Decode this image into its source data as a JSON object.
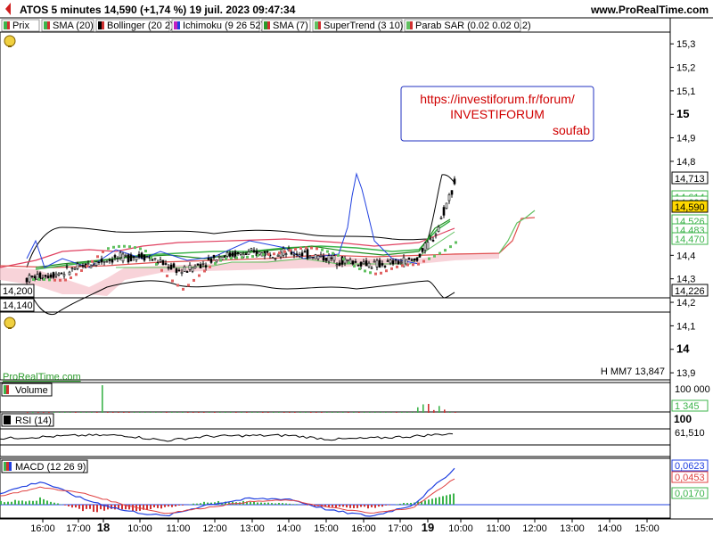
{
  "header": {
    "title": "ATOS 5 minutes 14,590 (+1,74 %) 19 juil. 2023 09:47:34",
    "site": "www.ProRealTime.com"
  },
  "legend": [
    {
      "label": "Prix",
      "color": "#3cb44b"
    },
    {
      "label": "SMA (20)",
      "color": "#3cb44b"
    },
    {
      "label": "Bollinger (20 2)",
      "color": "#000000"
    },
    {
      "label": "Ichimoku (9 26 52)",
      "color": "#c020c0"
    },
    {
      "label": "SMA (7)",
      "color": "#2a9a2a"
    },
    {
      "label": "SuperTrend (3 10)",
      "color": "#60c060"
    },
    {
      "label": "Parab SAR (0.02 0.02 0.2)",
      "color": "#60c060"
    }
  ],
  "annotation": {
    "line1": "https://investiforum.fr/forum/",
    "line2": "INVESTIFORUM",
    "line3": "soufab"
  },
  "watermark": "ProRealTime.com",
  "price_axis": {
    "ticks": [
      "15,3",
      "15,2",
      "15,1",
      "15",
      "14,9",
      "14,8",
      "14,4",
      "14,3",
      "14,2",
      "14,1",
      "14",
      "13,9"
    ],
    "badges": [
      {
        "text": "14,713",
        "color": "#ffffff",
        "border": "#000000"
      },
      {
        "text": "14,614",
        "color": "#ffffff",
        "border": "#3cb44b"
      },
      {
        "text": "14,600",
        "color": "#ffffff",
        "border": "#3cb44b"
      },
      {
        "text": "14,590",
        "color": "#ffd800",
        "border": "#000000"
      },
      {
        "text": "14,526",
        "color": "#ffffff",
        "border": "#3cb44b"
      },
      {
        "text": "14,483",
        "color": "#ffffff",
        "border": "#3cb44b"
      },
      {
        "text": "14,470",
        "color": "#ffffff",
        "border": "#3cb44b"
      },
      {
        "text": "14,226",
        "color": "#ffffff",
        "border": "#000000"
      }
    ],
    "left_levels": [
      "14,200",
      "14,140"
    ],
    "mm_label": "H MM7 13,847"
  },
  "panels": {
    "volume": {
      "label": "Volume",
      "ticks": [
        "100 000"
      ],
      "value": "1 345"
    },
    "rsi": {
      "label": "RSI (14)",
      "ticks": [
        "100"
      ],
      "value": "61,510"
    },
    "macd": {
      "label": "MACD (12 26 9)",
      "values": [
        "0,0623",
        "0,0453",
        "0,0170"
      ]
    }
  },
  "time_axis": {
    "ticks": [
      "16:00",
      "17:00",
      "18",
      "10:00",
      "11:00",
      "12:00",
      "13:00",
      "14:00",
      "15:00",
      "16:00",
      "17:00",
      "19",
      "10:00",
      "11:00",
      "12:00",
      "13:00",
      "14:00",
      "15:00"
    ],
    "bold": [
      "18",
      "19"
    ]
  },
  "chart_data": {
    "type": "line",
    "title": "ATOS 5 minutes 14,590 (+1,74 %) 19 juil. 2023 09:47:34",
    "ylim": [
      13.87,
      15.35
    ],
    "x": [
      "16:00",
      "17:00",
      "18",
      "10:00",
      "11:00",
      "12:00",
      "13:00",
      "14:00",
      "15:00",
      "16:00",
      "17:00",
      "19"
    ],
    "series": [
      {
        "name": "Prix",
        "values": [
          14.3,
          14.33,
          14.38,
          14.4,
          14.33,
          14.4,
          14.41,
          14.41,
          14.38,
          14.36,
          14.38,
          14.59
        ]
      },
      {
        "name": "SMA (20)",
        "values": [
          14.33,
          14.34,
          14.37,
          14.38,
          14.37,
          14.38,
          14.39,
          14.4,
          14.39,
          14.37,
          14.37,
          14.52
        ]
      },
      {
        "name": "SMA (7)",
        "values": [
          14.31,
          14.34,
          14.38,
          14.39,
          14.35,
          14.39,
          14.4,
          14.41,
          14.38,
          14.36,
          14.38,
          14.56
        ]
      },
      {
        "name": "Parab SAR (0.02 0.02 0.2)",
        "values": [
          14.28,
          14.32,
          14.42,
          14.43,
          14.27,
          14.37,
          14.43,
          14.42,
          14.41,
          14.33,
          14.35,
          14.48
        ]
      }
    ],
    "volume": [
      1200,
      800,
      100000,
      2500,
      3000,
      2200,
      2000,
      1800,
      2500,
      2000,
      35000,
      1345
    ],
    "rsi": [
      45,
      50,
      55,
      55,
      38,
      52,
      54,
      55,
      42,
      46,
      52,
      61.51
    ],
    "macd": {
      "macd": [
        0.02,
        0.04,
        0.01,
        -0.01,
        -0.02,
        0.0,
        0.01,
        0.01,
        -0.01,
        -0.02,
        0.0,
        0.0623
      ],
      "signal": [
        0.015,
        0.03,
        0.02,
        0.0,
        -0.015,
        -0.005,
        0.005,
        0.008,
        -0.005,
        -0.015,
        -0.005,
        0.0453
      ],
      "histogram": [
        0.005,
        0.01,
        -0.01,
        -0.01,
        -0.005,
        0.005,
        0.005,
        0.002,
        -0.005,
        -0.005,
        0.005,
        0.017
      ]
    }
  }
}
